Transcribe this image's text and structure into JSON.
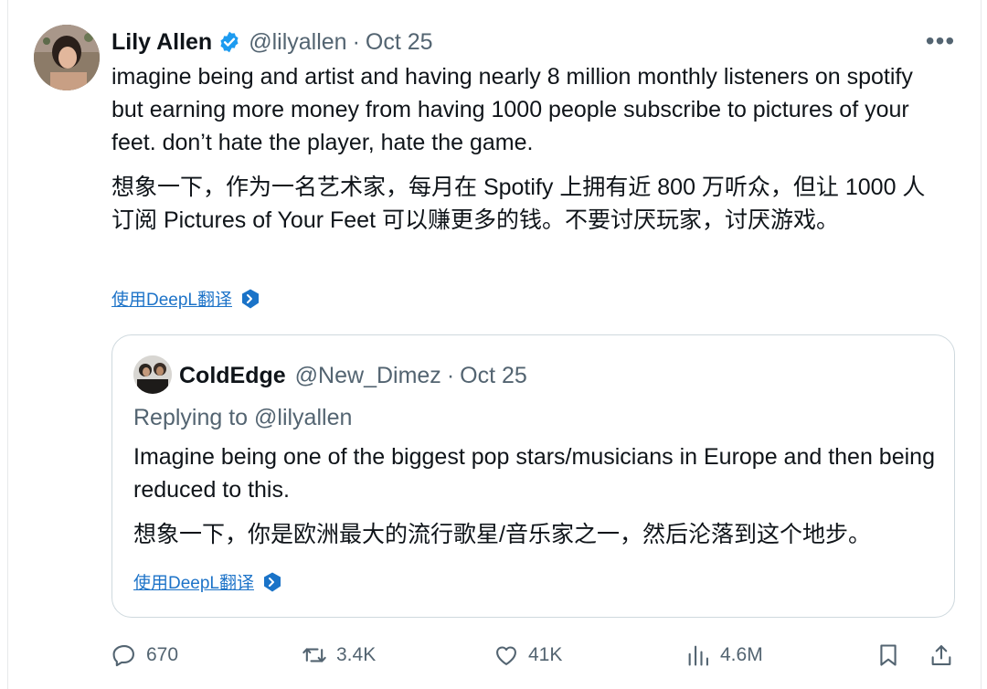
{
  "tweet": {
    "author_name": "Lily Allen",
    "handle": "@lilyallen",
    "separator": "·",
    "date": "Oct 25",
    "more_label": "•••",
    "text_en": "imagine being and artist and having nearly 8 million monthly listeners on spotify but earning more money from having 1000 people subscribe to pictures of your feet. don’t hate the player, hate the game.",
    "text_cn": "想象一下，作为一名艺术家，每月在 Spotify 上拥有近 800 万听众，但让 1000 人订阅 Pictures of Your Feet 可以赚更多的钱。不要讨厌玩家，讨厌游戏。",
    "translate_link": "使用DeepL翻译"
  },
  "quote": {
    "author_name": "ColdEdge",
    "handle": "@New_Dimez",
    "separator": "·",
    "date": "Oct 25",
    "replying_to": "Replying to @lilyallen",
    "text_en": "Imagine being one of the biggest pop stars/musicians in Europe and then being reduced to this.",
    "text_cn": "想象一下，你是欧洲最大的流行歌星/音乐家之一，然后沦落到这个地步。",
    "translate_link": "使用DeepL翻译"
  },
  "actions": {
    "replies": "670",
    "retweets": "3.4K",
    "likes": "41K",
    "views": "4.6M"
  },
  "colors": {
    "text": "#0f1419",
    "secondary": "#536471",
    "verified_blue": "#1d9bf0",
    "link_blue": "#1d73c8",
    "border": "#cfd9de"
  },
  "icons": [
    "verified-badge-icon",
    "more-icon",
    "deepl-icon",
    "reply-icon",
    "retweet-icon",
    "like-icon",
    "views-icon",
    "bookmark-icon",
    "share-icon"
  ]
}
